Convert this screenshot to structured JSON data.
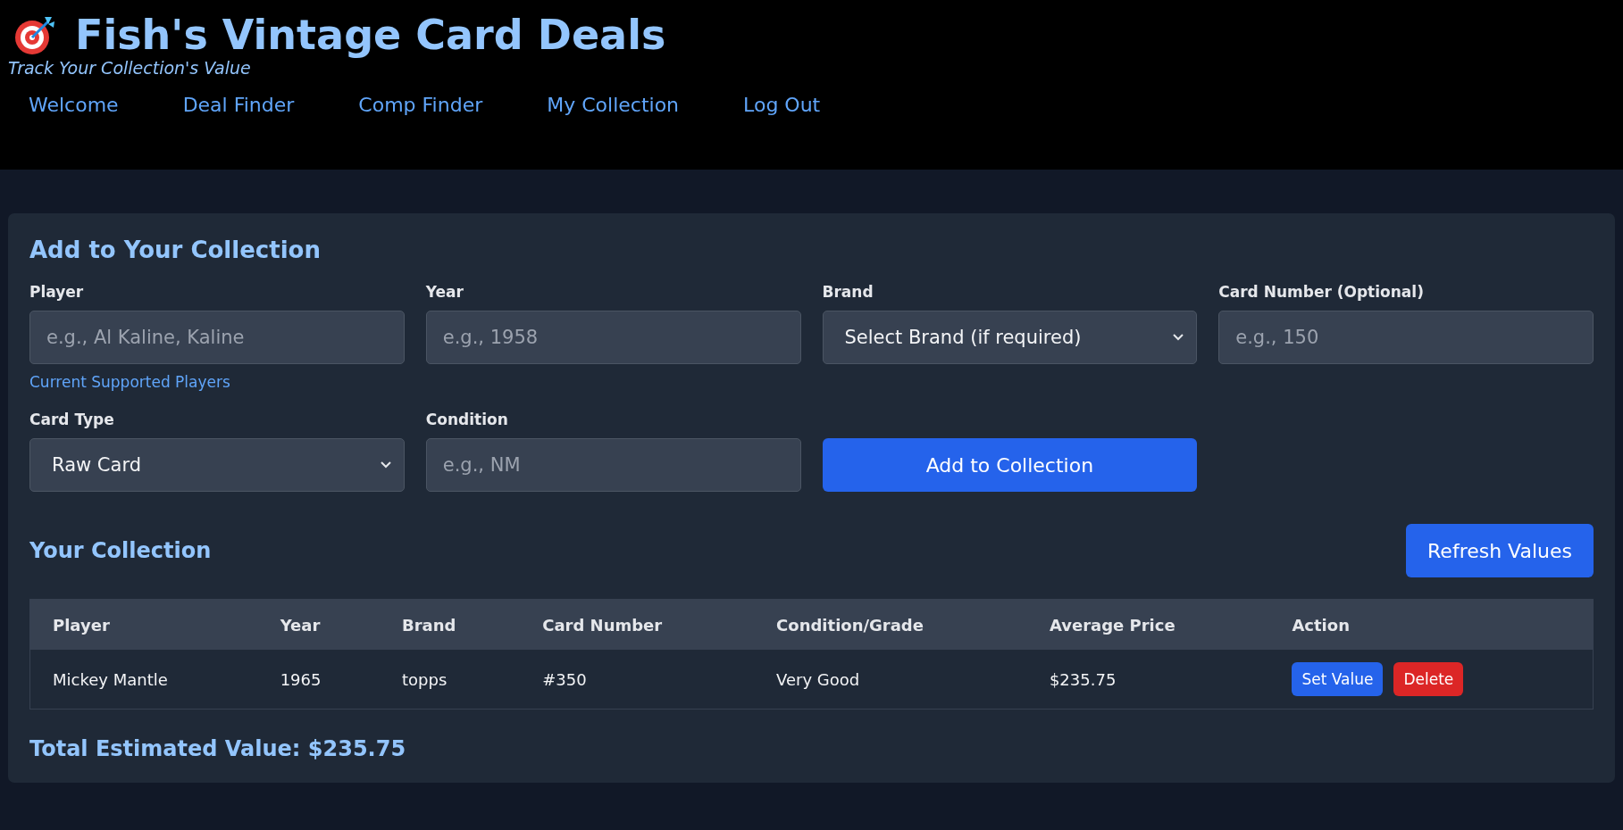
{
  "header": {
    "title": "Fish's Vintage Card Deals",
    "subtitle": "Track Your Collection's Value"
  },
  "nav": [
    {
      "label": "Welcome"
    },
    {
      "label": "Deal Finder"
    },
    {
      "label": "Comp Finder"
    },
    {
      "label": "My Collection"
    },
    {
      "label": "Log Out"
    }
  ],
  "add_form": {
    "heading": "Add to Your Collection",
    "fields": [
      {
        "kind": "input",
        "label": "Player",
        "placeholder": "e.g., Al Kaline, Kaline",
        "link": "Current Supported Players"
      },
      {
        "kind": "input",
        "label": "Year",
        "placeholder": "e.g., 1958"
      },
      {
        "kind": "select",
        "label": "Brand",
        "value": "Select Brand (if required)"
      },
      {
        "kind": "input",
        "label": "Card Number (Optional)",
        "placeholder": "e.g., 150"
      },
      {
        "kind": "select",
        "label": "Card Type",
        "value": "Raw Card"
      },
      {
        "kind": "input",
        "label": "Condition",
        "placeholder": "e.g., NM"
      },
      {
        "kind": "button",
        "label": "Add to Collection"
      }
    ]
  },
  "collection": {
    "heading": "Your Collection",
    "refresh_button": "Refresh Values",
    "table": {
      "columns": [
        "Player",
        "Year",
        "Brand",
        "Card Number",
        "Condition/Grade",
        "Average Price",
        "Action"
      ],
      "rows": [
        {
          "cells": [
            "Mickey Mantle",
            "1965",
            "topps",
            "#350",
            "Very Good",
            "$235.75"
          ],
          "actions": [
            "Set Value",
            "Delete"
          ]
        }
      ]
    },
    "total": "Total Estimated Value: $235.75"
  }
}
